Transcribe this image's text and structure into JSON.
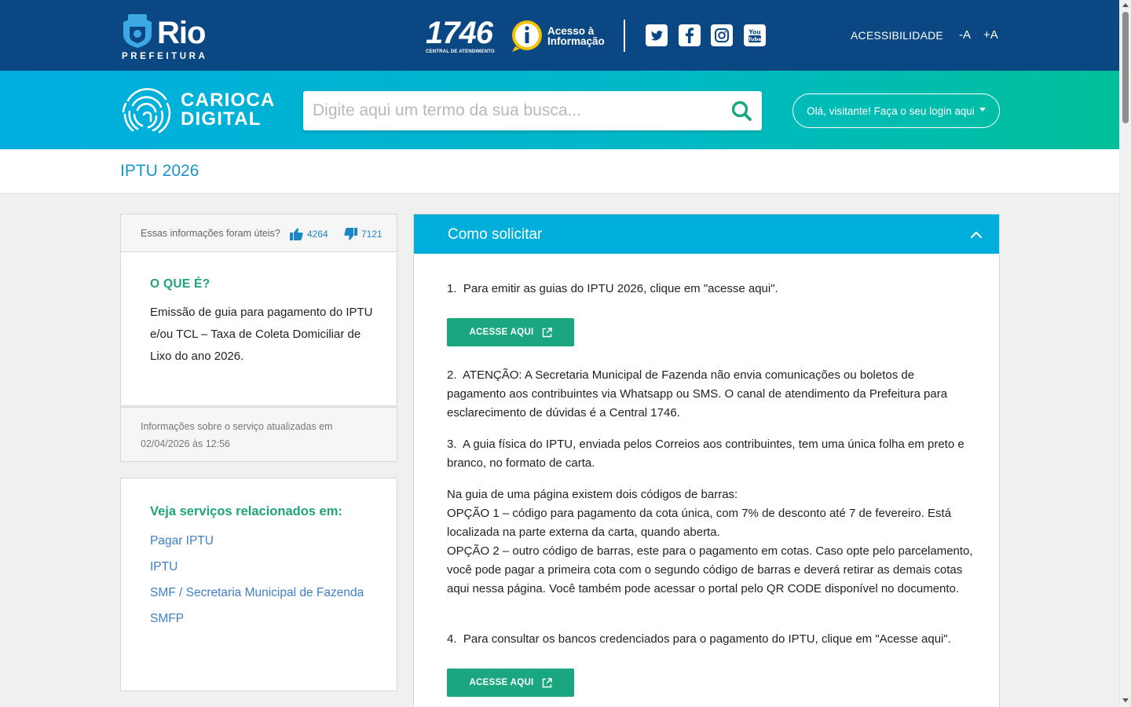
{
  "header": {
    "logo_rio": "Rio",
    "logo_prefeitura": "PREFEITURA",
    "logo_1746": "1746",
    "logo_1746_sub": "CENTRAL DE ATENDIMENTO",
    "acesso_line1": "Acesso à",
    "acesso_line2": "Informação",
    "social": [
      "twitter-icon",
      "facebook-icon",
      "instagram-icon",
      "youtube-icon"
    ],
    "acessibilidade": "ACESSIBILIDADE",
    "font_decrease": "-A",
    "font_increase": "+A",
    "bg_color": "#0b4782"
  },
  "search": {
    "logo_line1": "CARIOCA",
    "logo_line2": "DIGITAL",
    "placeholder": "Digite aqui um termo da sua busca...",
    "login_label": "Olá, visitante! Faça o seu login aqui",
    "accent_color": "#00aee0"
  },
  "page": {
    "title": "IPTU 2026"
  },
  "feedback": {
    "question": "Essas informações foram úteis?",
    "likes": "4264",
    "dislikes": "7121"
  },
  "about": {
    "heading": "O QUE É?",
    "text": "Emissão de guia para pagamento do IPTU e/ou TCL – Taxa de Coleta Domiciliar de Lixo do ano 2026."
  },
  "updated": {
    "text": "Informações sobre o serviço atualizadas em 02/04/2026 às 12:56"
  },
  "related": {
    "heading": "Veja serviços relacionados em:",
    "links": [
      "Pagar IPTU",
      "IPTU",
      "SMF / Secretaria Municipal de Fazenda",
      "SMFP"
    ]
  },
  "howto": {
    "title": "Como solicitar",
    "step1": "Para emitir as guias do IPTU 2026, clique em \"acesse aqui\".",
    "button1": "ACESSE AQUI",
    "step2": "ATENÇÃO: A Secretaria Municipal de Fazenda não envia comunicações ou boletos de pagamento aos contribuintes via Whatsapp ou SMS. O canal de atendimento da Prefeitura para esclarecimento de dúvidas é a Central 1746.",
    "step3": "A guia física do IPTU, enviada pelos Correios aos contribuintes, tem uma única folha em preto e branco, no formato de carta.",
    "info_line1": "Na guia de uma página existem dois códigos de barras:",
    "info_line2": "OPÇÃO 1 – código para pagamento da cota única, com 7% de desconto até 7 de fevereiro. Está localizada na parte externa da carta, quando aberta.",
    "info_line3": "OPÇÃO 2 – outro código de barras, este para o pagamento em cotas. Caso opte pelo parcelamento, você pode pagar a primeira cota com o segundo código de barras e deverá retirar as demais cotas aqui nessa página. Você também pode acessar o portal pelo QR CODE disponível no documento.",
    "step4": "Para consultar os bancos credenciados para o pagamento do IPTU, clique em \"Acesse aqui\".",
    "button2": "ACESSE AQUI",
    "cta_color": "#1aa67e"
  }
}
